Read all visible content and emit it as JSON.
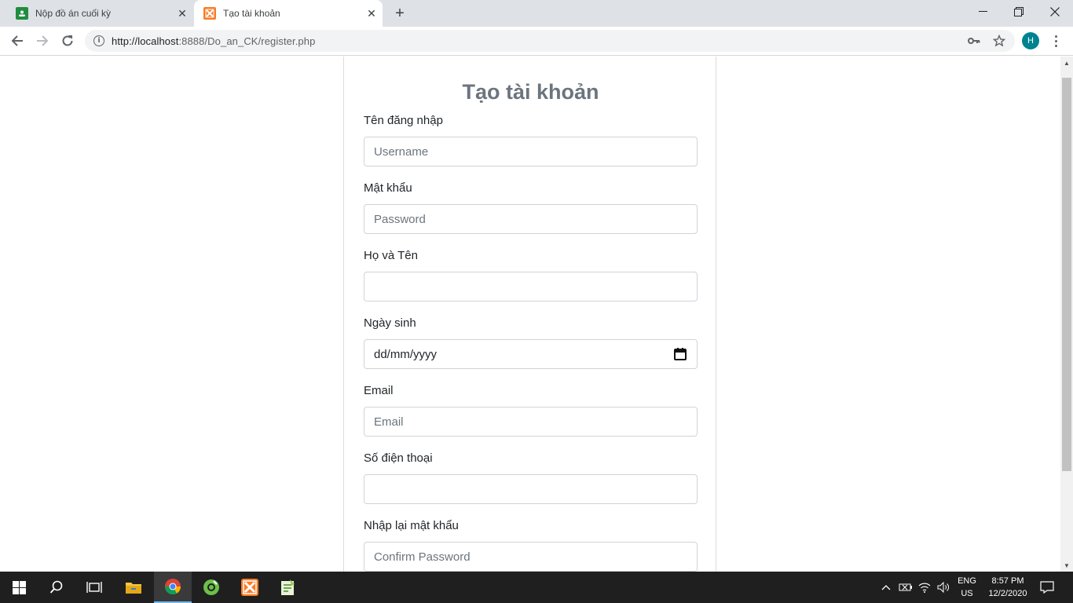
{
  "browser": {
    "tabs": [
      {
        "title": "Nộp đồ án cuối kỳ",
        "favicon": "google-classroom-icon",
        "active": false
      },
      {
        "title": "Tạo tài khoản",
        "favicon": "xampp-icon",
        "active": true
      }
    ],
    "url_host": "http://localhost",
    "url_rest": ":8888/Do_an_CK/register.php",
    "profile_initial": "H"
  },
  "page": {
    "heading": "Tạo tài khoản",
    "fields": {
      "username": {
        "label": "Tên đăng nhập",
        "placeholder": "Username",
        "value": ""
      },
      "password": {
        "label": "Mật khẩu",
        "placeholder": "Password",
        "value": ""
      },
      "fullname": {
        "label": "Họ và Tên",
        "placeholder": "",
        "value": ""
      },
      "birthday": {
        "label": "Ngày sinh",
        "value": "dd/mm/yyyy"
      },
      "email": {
        "label": "Email",
        "placeholder": "Email",
        "value": ""
      },
      "phone": {
        "label": "Số điện thoại",
        "placeholder": "",
        "value": ""
      },
      "confirm": {
        "label": "Nhập lại mật khẩu",
        "placeholder": "Confirm Password",
        "value": ""
      }
    }
  },
  "taskbar": {
    "apps": [
      "windows-start-icon",
      "search-icon",
      "task-view-icon",
      "file-explorer-icon",
      "chrome-icon",
      "coccoc-icon",
      "xampp-icon",
      "notepad-plus-plus-icon"
    ],
    "lang_line1": "ENG",
    "lang_line2": "US",
    "time": "8:57 PM",
    "date": "12/2/2020"
  },
  "colors": {
    "heading": "#6c757d",
    "avatar": "#00838f",
    "taskbar": "#1f1f1f"
  }
}
